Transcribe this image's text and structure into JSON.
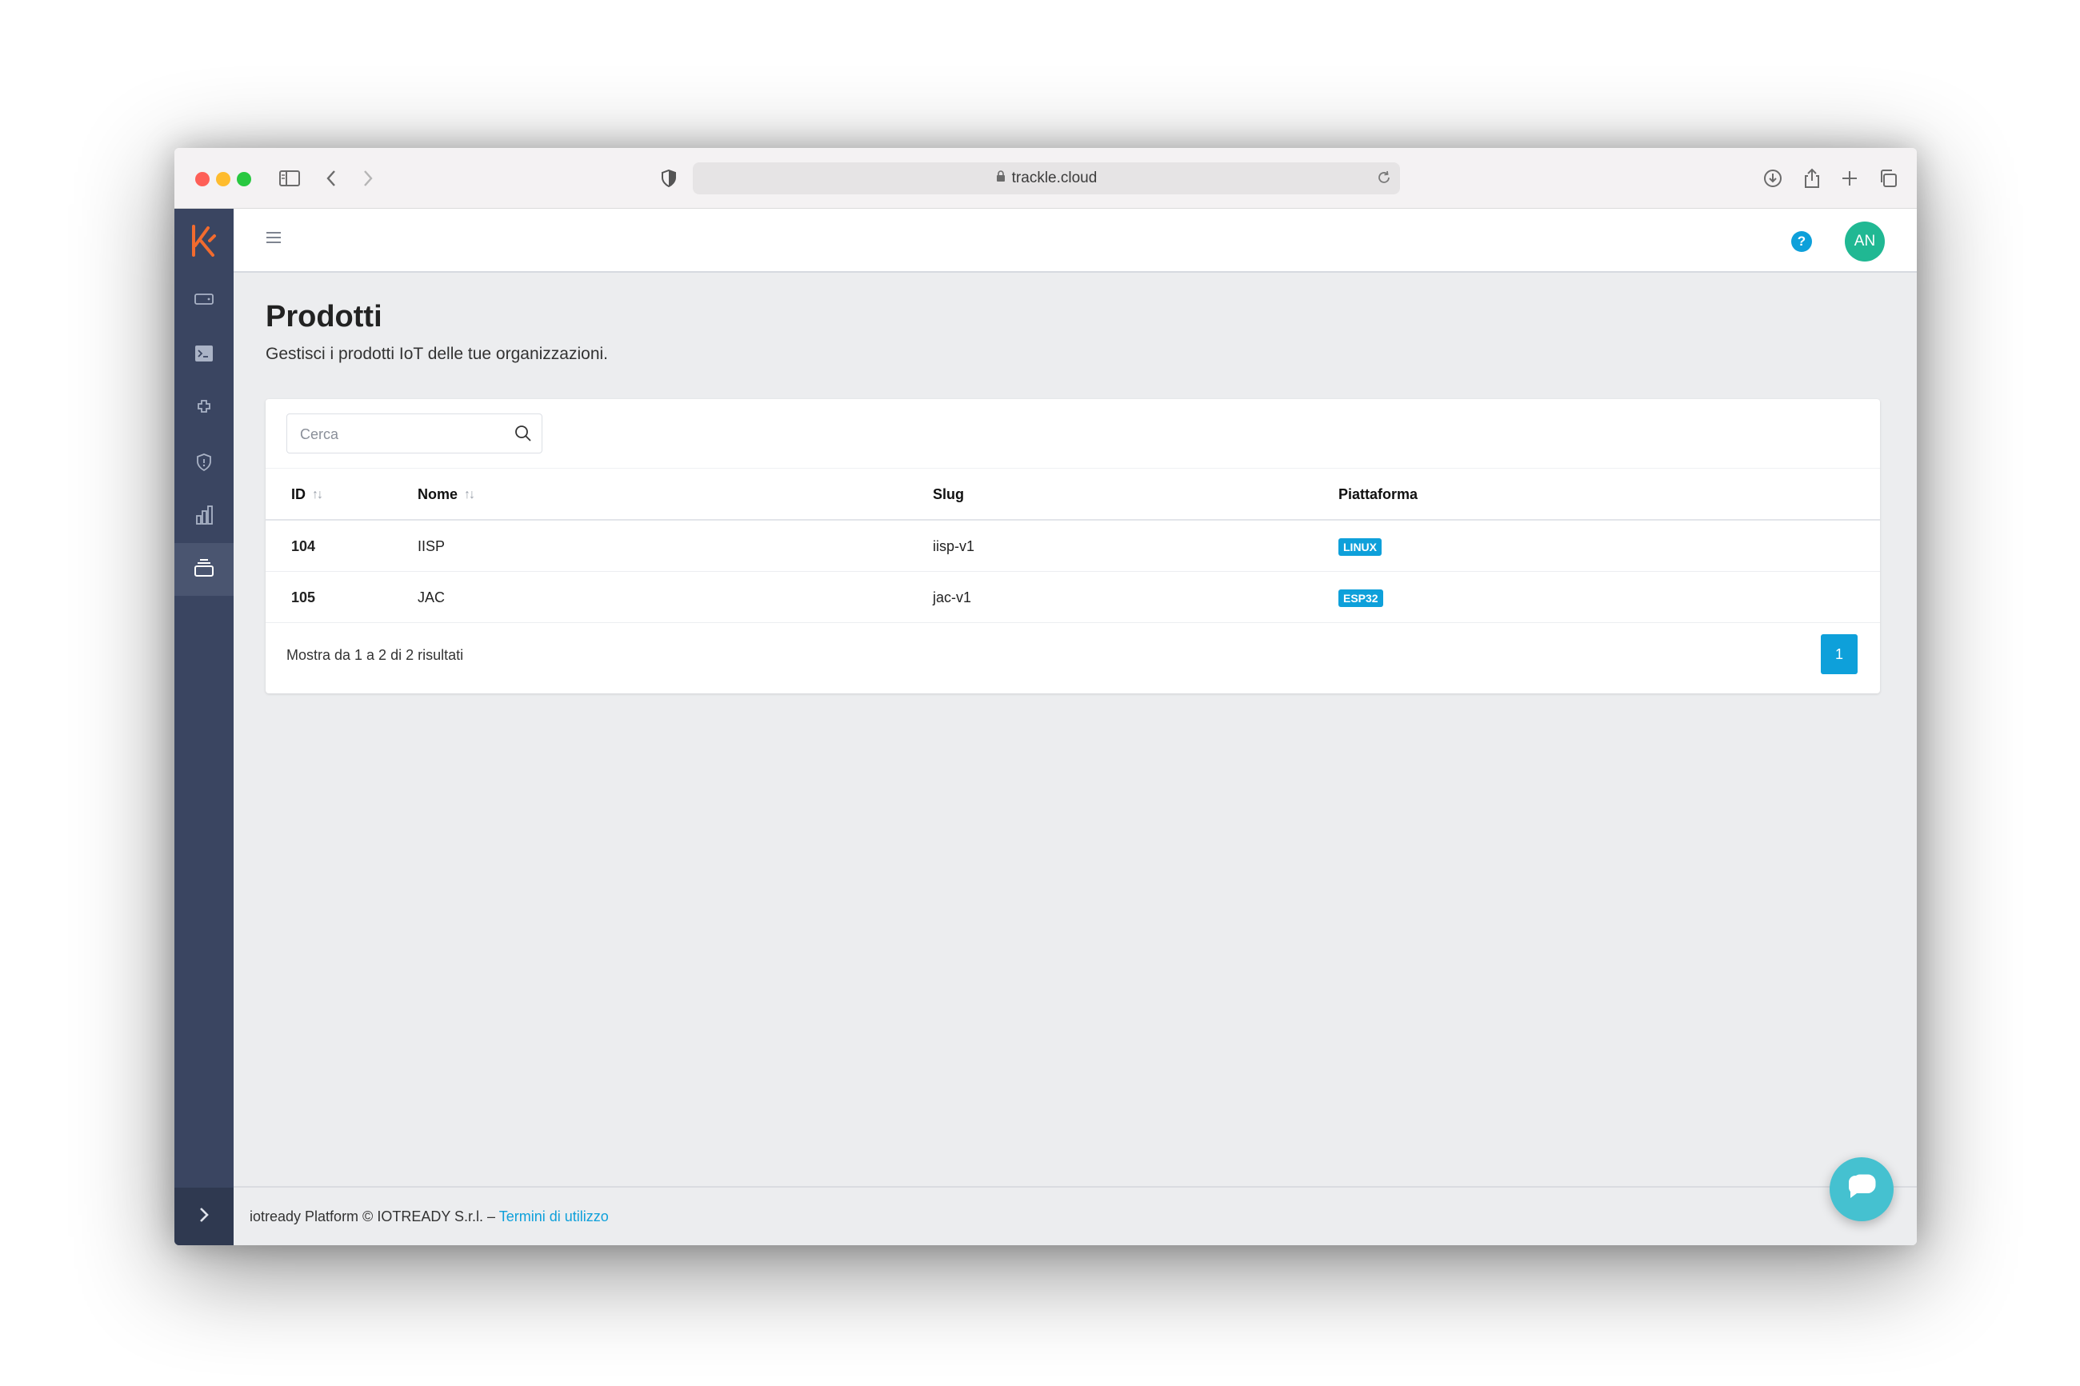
{
  "browser": {
    "url": "trackle.cloud"
  },
  "header": {
    "help_label": "?",
    "avatar_initials": "AN"
  },
  "page": {
    "title": "Prodotti",
    "subtitle": "Gestisci i prodotti IoT delle tue organizzazioni."
  },
  "search": {
    "placeholder": "Cerca"
  },
  "table": {
    "columns": [
      "ID",
      "Nome",
      "Slug",
      "Piattaforma"
    ],
    "sort_glyph": "↑↓",
    "rows": [
      {
        "id": "104",
        "name": "IISP",
        "slug": "iisp-v1",
        "platform": "LINUX"
      },
      {
        "id": "105",
        "name": "JAC",
        "slug": "jac-v1",
        "platform": "ESP32"
      }
    ],
    "summary": "Mostra da 1 a 2 di 2 risultati",
    "current_page": "1"
  },
  "footer": {
    "text": "iotready Platform © IOTREADY S.r.l. – ",
    "link": "Termini di utilizzo"
  },
  "colors": {
    "sidebar": "#3a4561",
    "accent": "#0ea0da",
    "avatar": "#20b893",
    "logo": "#f26b2e",
    "chat": "#45c1d0"
  },
  "icons": {
    "sidebar": [
      "device-icon",
      "terminal-icon",
      "plugin-icon",
      "shield-icon",
      "analytics-icon",
      "products-icon"
    ]
  }
}
